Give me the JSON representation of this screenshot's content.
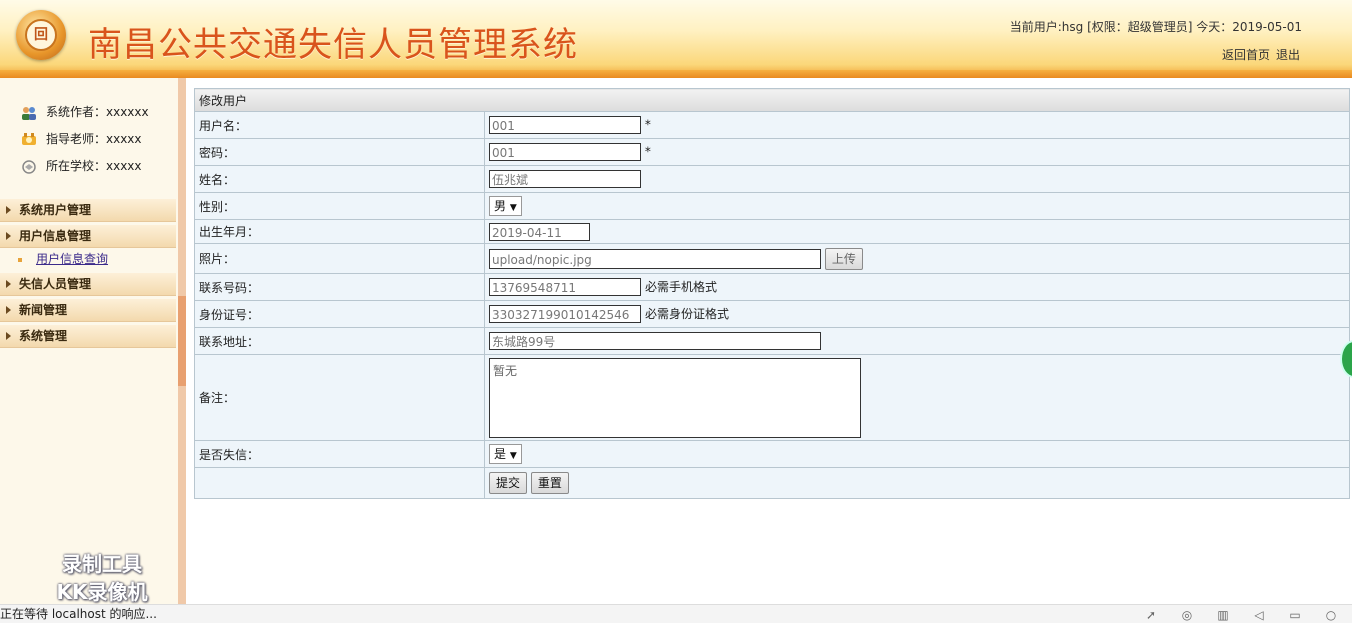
{
  "header": {
    "logo_text": "回",
    "title": "南昌公共交通失信人员管理系统",
    "user_info": "当前用户:hsg [权限：超级管理员] 今天：2019-05-01",
    "links": [
      "返回首页",
      "退出"
    ]
  },
  "sidebar": {
    "info": [
      {
        "icon": "people-icon",
        "text": "系统作者：xxxxxx"
      },
      {
        "icon": "teacher-icon",
        "text": "指导老师：xxxxx"
      },
      {
        "icon": "school-icon",
        "text": "所在学校：xxxxx"
      }
    ],
    "menu": [
      "系统用户管理",
      "用户信息管理",
      "失信人员管理",
      "新闻管理",
      "系统管理"
    ],
    "sub_item": "用户信息查询",
    "watermark_line1": "录制工具",
    "watermark_line2": "KK录像机"
  },
  "form": {
    "title": "修改用户",
    "username_label": "用户名：",
    "username_value": "001",
    "password_label": "密码：",
    "password_value": "001",
    "required_mark": "*",
    "name_label": "姓名：",
    "name_value": "伍兆斌",
    "gender_label": "性别：",
    "gender_value": "男",
    "dropdown_arrow": "▼",
    "birth_label": "出生年月：",
    "birth_value": "2019-04-11",
    "photo_label": "照片：",
    "photo_value": "upload/nopic.jpg",
    "upload_button": "上传",
    "phone_label": "联系号码：",
    "phone_value": "13769548711",
    "phone_hint": "必需手机格式",
    "id_label": "身份证号：",
    "id_value": "330327199010142546",
    "id_hint": "必需身份证格式",
    "address_label": "联系地址：",
    "address_value": "东城路99号",
    "remark_label": "备注：",
    "remark_value": "暂无",
    "dishonest_label": "是否失信：",
    "dishonest_value": "是",
    "submit_button": "提交",
    "reset_button": "重置"
  },
  "statusbar": {
    "text": "正在等待 localhost 的响应..."
  },
  "colors": {
    "title_orange": "#d9541c",
    "header_gradient_bottom": "#f1a93b",
    "sidebar_bg": "#fdf8ea",
    "form_cell_bg": "#eef5fa"
  }
}
